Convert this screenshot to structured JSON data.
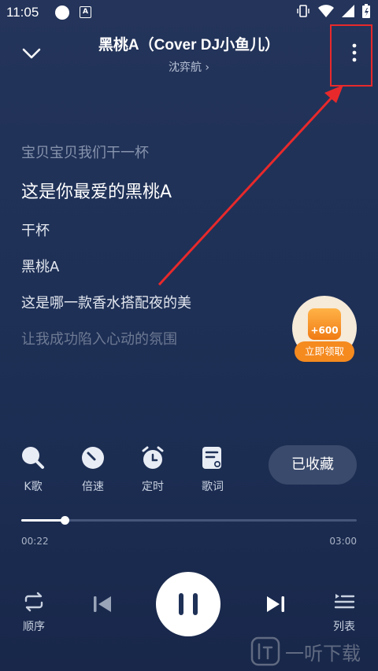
{
  "status_bar": {
    "time": "11:05"
  },
  "header": {
    "title": "黑桃A（Cover DJ小鱼儿）",
    "artist": "沈弈航 ›"
  },
  "lyrics": [
    "宝贝宝贝我们干一杯",
    "这是你最爱的黑桃A",
    "干杯",
    "黑桃A",
    "这是哪一款香水搭配夜的美",
    "让我成功陷入心动的氛围"
  ],
  "reward": {
    "amount": "+600",
    "button_label": "立即领取"
  },
  "functions": {
    "k_song": "K歌",
    "speed": "倍速",
    "timer": "定时",
    "lyrics": "歌词"
  },
  "favorite_label": "已收藏",
  "progress": {
    "current": "00:22",
    "total": "03:00",
    "fraction": 0.13
  },
  "controls": {
    "order_label": "顺序",
    "list_label": "列表"
  },
  "watermark": {
    "text": "一听下载"
  },
  "colors": {
    "background": "#1f3157",
    "highlight": "#e8292b",
    "reward_orange": "#f58a1f"
  },
  "icons": [
    "chevron-down-icon",
    "more-vertical-icon",
    "microphone-icon",
    "speed-dial-icon",
    "alarm-clock-icon",
    "lyrics-note-icon",
    "repeat-icon",
    "skip-previous-icon",
    "pause-icon",
    "skip-next-icon",
    "playlist-icon"
  ]
}
